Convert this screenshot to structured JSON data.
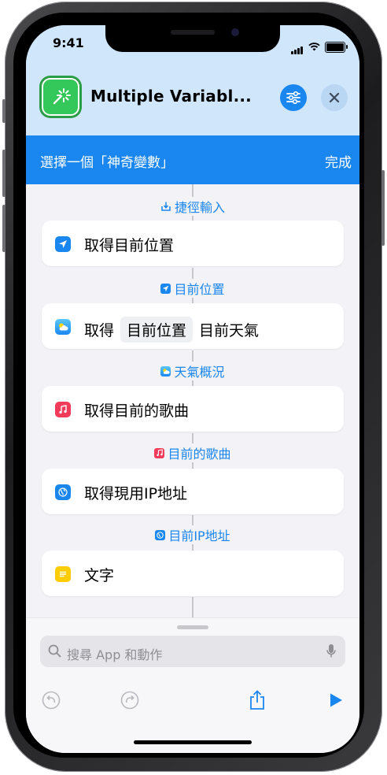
{
  "status_bar": {
    "time": "9:41"
  },
  "header": {
    "title": "Multiple Variabl...",
    "app_icon": "magic-wand-icon",
    "settings_icon": "sliders-icon",
    "close_icon": "close-icon"
  },
  "banner": {
    "prompt": "選擇一個「神奇變數」",
    "done_label": "完成"
  },
  "actions": [
    {
      "id": "input-label",
      "variable_label": "捷徑輸入",
      "icon": "shortcut-input-icon"
    },
    {
      "card_text": "取得目前位置",
      "icon": "location-icon",
      "icon_color": "#1a86f0"
    },
    {
      "variable_label": "目前位置",
      "icon": "location-icon"
    },
    {
      "card_text_prefix": "取得",
      "card_param": "目前位置",
      "card_text_suffix": "目前天氣",
      "icon": "weather-icon"
    },
    {
      "variable_label": "天氣概況",
      "icon": "weather-icon"
    },
    {
      "card_text": "取得目前的歌曲",
      "icon": "music-icon",
      "icon_color": "#f23a5a"
    },
    {
      "variable_label": "目前的歌曲",
      "icon": "music-icon"
    },
    {
      "card_text": "取得現用IP地址",
      "icon": "globe-icon",
      "icon_color": "#1a86f0"
    },
    {
      "variable_label": "目前IP地址",
      "icon": "globe-icon"
    },
    {
      "card_text": "文字",
      "icon": "note-icon",
      "icon_color": "#ffcc00"
    }
  ],
  "bottom": {
    "search_placeholder": "搜尋 App 和動作",
    "toolbar": [
      "undo-icon",
      "redo-icon",
      "share-icon",
      "play-icon"
    ]
  },
  "colors": {
    "accent": "#1a86f0",
    "header_bg": "#cfe6fb",
    "app_icon_bg": "#34c759"
  }
}
